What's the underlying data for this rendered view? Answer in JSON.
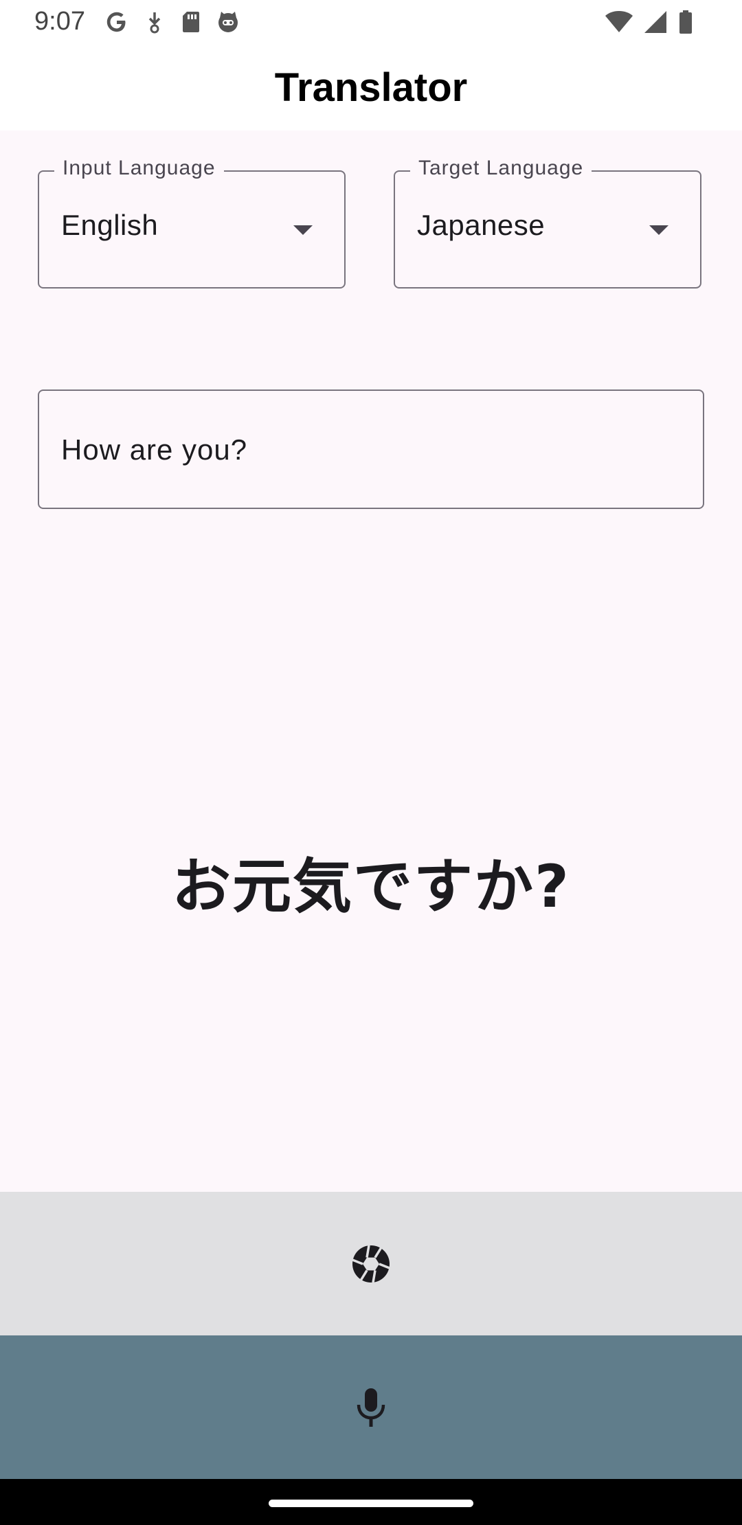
{
  "status_bar": {
    "time": "9:07",
    "left_icons": [
      "google-icon",
      "download-icon",
      "sd-card-icon",
      "cat-face-icon"
    ],
    "right_icons": [
      "wifi-icon",
      "signal-icon",
      "battery-icon"
    ]
  },
  "app_bar": {
    "title": "Translator"
  },
  "input_language": {
    "label": "Input Language",
    "value": "English"
  },
  "target_language": {
    "label": "Target Language",
    "value": "Japanese"
  },
  "text_input": {
    "value": "How are you?"
  },
  "translation": {
    "text": "お元気ですか?"
  },
  "actions": {
    "camera_icon": "camera-shutter-icon",
    "mic_icon": "microphone-icon"
  },
  "colors": {
    "background": "#fdf7fb",
    "camera_bar": "#e0e0e2",
    "mic_bar": "#607d8b",
    "outline": "#79747e"
  }
}
